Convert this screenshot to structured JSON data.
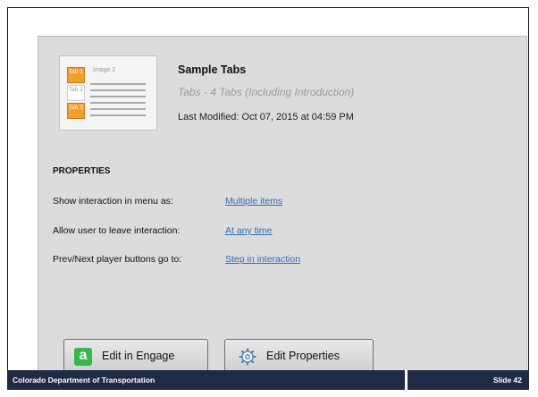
{
  "interaction": {
    "title": "Sample Tabs",
    "subtitle": "Tabs - 4 Tabs (Including Introduction)",
    "last_modified": "Last Modified: Oct 07, 2015 at 04:59 PM",
    "thumbnail": {
      "image_label": "Image 2",
      "tabs": [
        "Tab 1",
        "Tab 2",
        "Tab 3"
      ]
    }
  },
  "properties": {
    "heading": "PROPERTIES",
    "rows": [
      {
        "label": "Show interaction in menu as:",
        "value": "Multiple items"
      },
      {
        "label": "Allow user to leave interaction:",
        "value": "At any time"
      },
      {
        "label": "Prev/Next player buttons go to:",
        "value": "Step in interaction"
      }
    ]
  },
  "buttons": {
    "edit_engage": "Edit in Engage",
    "edit_properties": "Edit Properties"
  },
  "footer": {
    "organization": "Colorado Department of Transportation",
    "slide": "Slide 42"
  },
  "colors": {
    "link": "#2f6db5",
    "footer_bg": "#1f2b45",
    "tab_orange": "#f0a030",
    "engage_green": "#39b54a"
  }
}
